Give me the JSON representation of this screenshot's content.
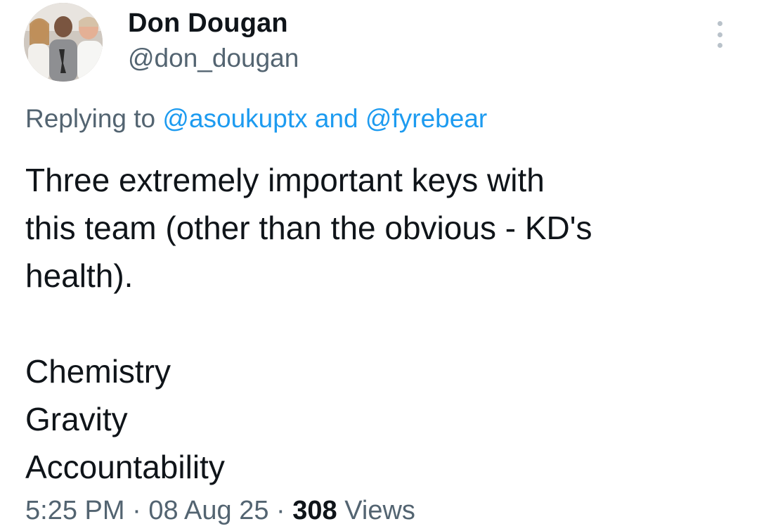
{
  "author": {
    "display_name": "Don Dougan",
    "handle": "@don_dougan",
    "avatar_icon": "profile-photo"
  },
  "reply_context": {
    "prefix": "Replying to",
    "mention1": "@asoukuptx",
    "conjunction": "and",
    "mention2": "@fyrebear"
  },
  "tweet": {
    "line1": "Three extremely important keys with",
    "line2": "this team (other than the obvious - KD's",
    "line3": "health).",
    "item1": "Chemistry",
    "item2": "Gravity",
    "item3": "Accountability"
  },
  "meta": {
    "time": "5:25 PM",
    "separator": "·",
    "date": "08 Aug 25",
    "views_count": "308",
    "views_label": "Views"
  },
  "icons": {
    "more": "more-vertical-icon"
  },
  "colors": {
    "link": "#1d9bf0",
    "secondary_text": "#536471",
    "primary_text": "#0f1419"
  }
}
